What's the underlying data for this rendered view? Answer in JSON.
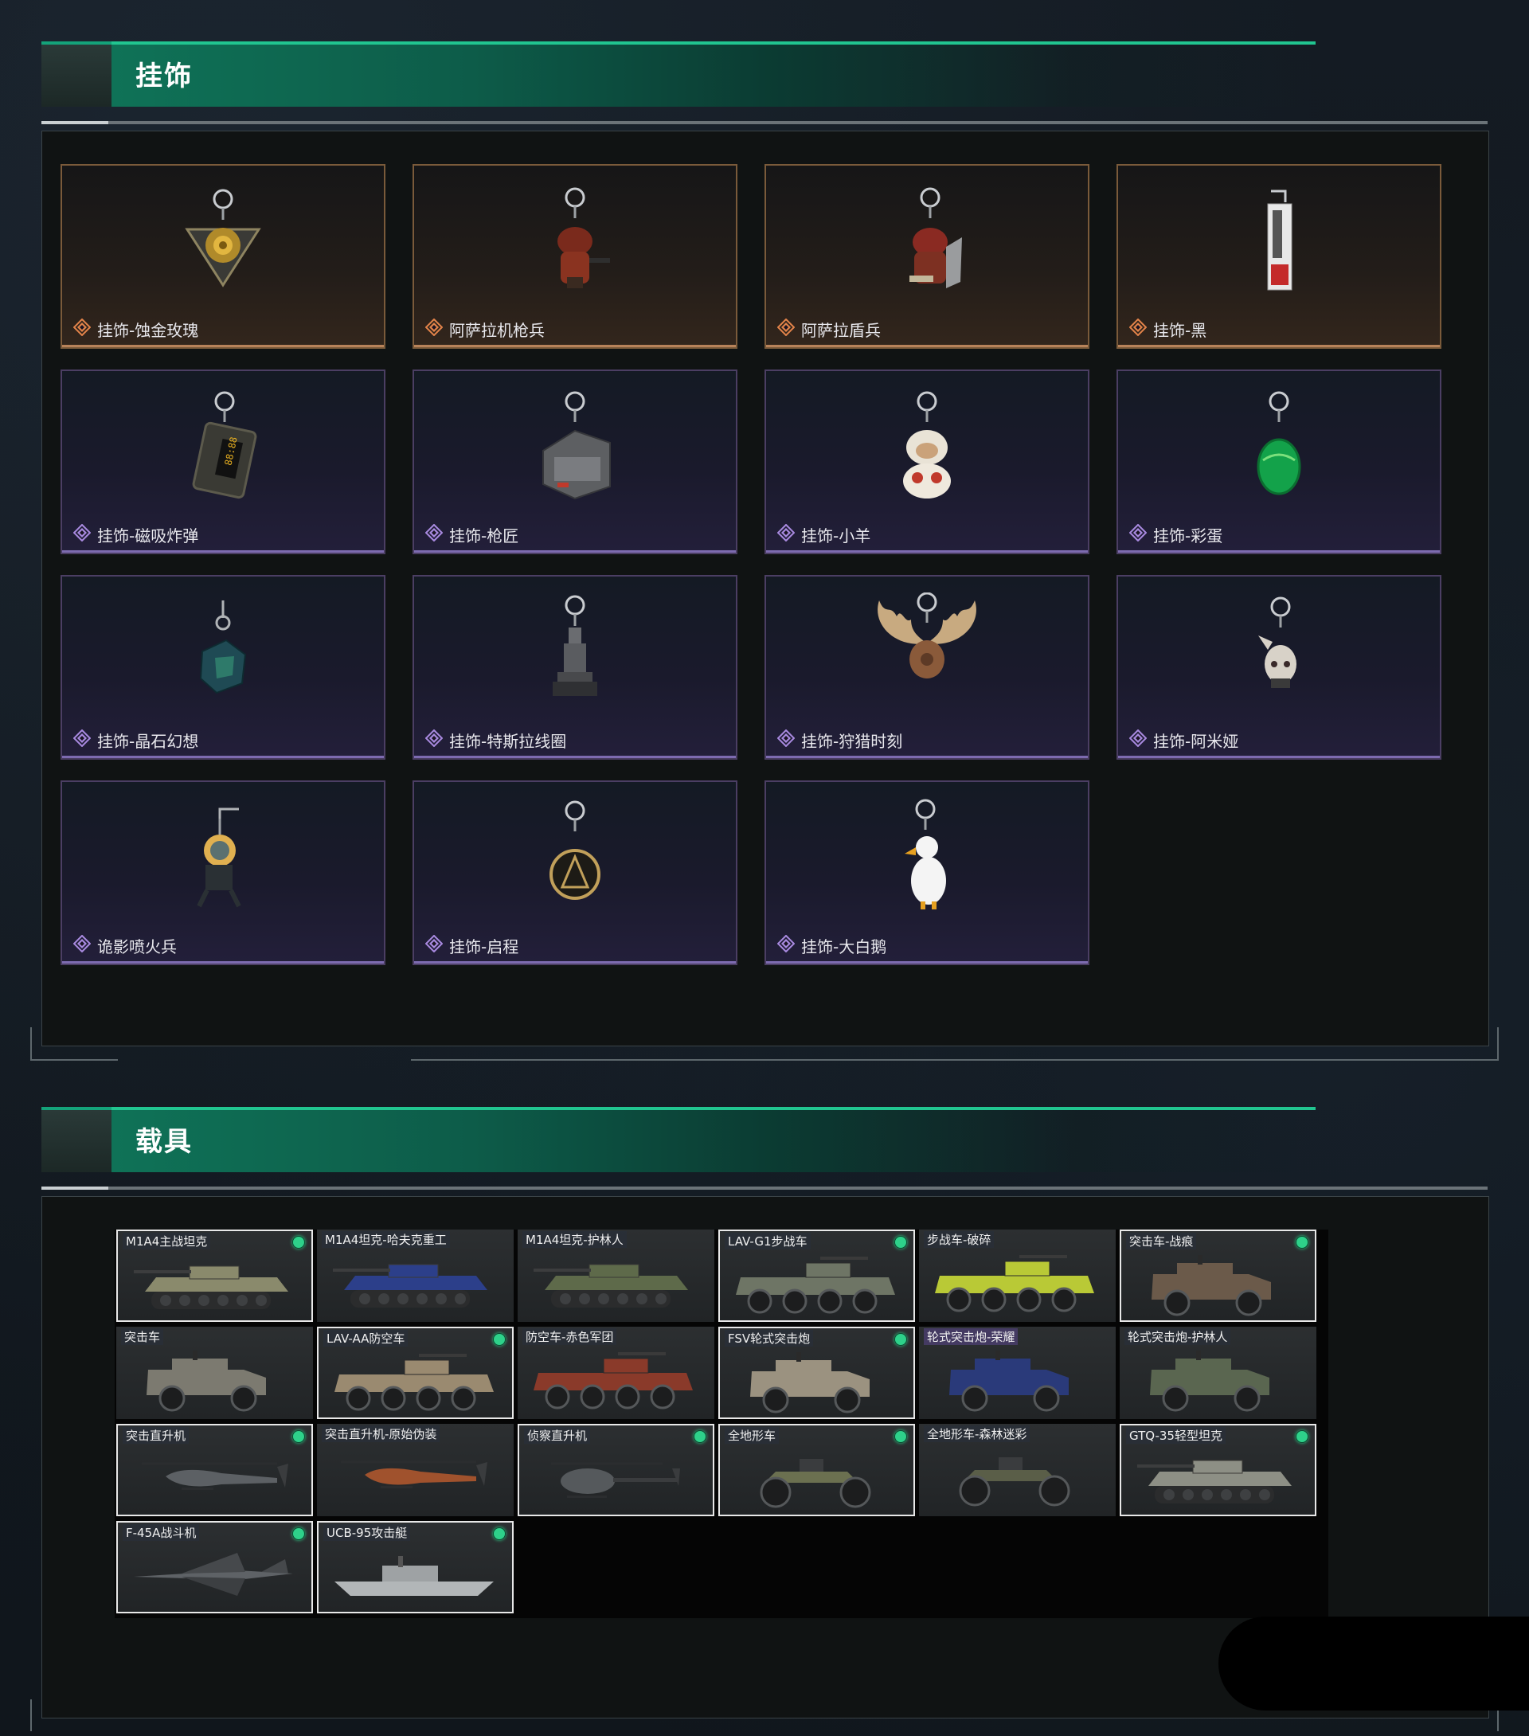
{
  "sections": {
    "charms": {
      "title": "挂饰"
    },
    "vehicles": {
      "title": "载具"
    }
  },
  "charms": [
    {
      "name": "挂饰-蚀金玫瑰",
      "rarity": "gold",
      "icon": "gilded-rose-charm"
    },
    {
      "name": "阿萨拉机枪兵",
      "rarity": "gold",
      "icon": "asara-gunner-charm"
    },
    {
      "name": "阿萨拉盾兵",
      "rarity": "gold",
      "icon": "asara-shield-charm"
    },
    {
      "name": "挂饰-黑",
      "rarity": "gold",
      "icon": "black-tag-charm"
    },
    {
      "name": "挂饰-磁吸炸弹",
      "rarity": "purple",
      "icon": "magnetic-bomb-charm"
    },
    {
      "name": "挂饰-枪匠",
      "rarity": "purple",
      "icon": "gunsmith-case-charm"
    },
    {
      "name": "挂饰-小羊",
      "rarity": "purple",
      "icon": "lamb-charm"
    },
    {
      "name": "挂饰-彩蛋",
      "rarity": "purple",
      "icon": "easter-egg-charm"
    },
    {
      "name": "挂饰-晶石幻想",
      "rarity": "purple",
      "icon": "crystal-cube-charm"
    },
    {
      "name": "挂饰-特斯拉线圈",
      "rarity": "purple",
      "icon": "tesla-coil-charm"
    },
    {
      "name": "挂饰-狩猎时刻",
      "rarity": "purple",
      "icon": "moose-antler-charm"
    },
    {
      "name": "挂饰-阿米娅",
      "rarity": "purple",
      "icon": "amiya-charm"
    },
    {
      "name": "诡影喷火兵",
      "rarity": "purple",
      "icon": "flamethrower-charm"
    },
    {
      "name": "挂饰-启程",
      "rarity": "purple",
      "icon": "departure-medal-charm"
    },
    {
      "name": "挂饰-大白鹅",
      "rarity": "purple",
      "icon": "white-goose-charm"
    }
  ],
  "vehicles": [
    {
      "name": "M1A4主战坦克",
      "owned": true,
      "kind": "tank",
      "color": "#8a8a6c"
    },
    {
      "name": "M1A4坦克-哈夫克重工",
      "owned": false,
      "kind": "tank",
      "color": "#2c3f8a"
    },
    {
      "name": "M1A4坦克-护林人",
      "owned": false,
      "kind": "tank",
      "color": "#5e6a4a"
    },
    {
      "name": "LAV-G1步战车",
      "owned": true,
      "kind": "apc",
      "color": "#6e7565"
    },
    {
      "name": "步战车-破碎",
      "owned": false,
      "kind": "apc",
      "color": "#b9c936"
    },
    {
      "name": "突击车-战痕",
      "owned": true,
      "kind": "truck",
      "color": "#6b5a4a"
    },
    {
      "name": "突击车",
      "owned": false,
      "kind": "truck",
      "color": "#7c7a70"
    },
    {
      "name": "LAV-AA防空车",
      "owned": true,
      "kind": "apc",
      "color": "#9a8a70"
    },
    {
      "name": "防空车-赤色军团",
      "owned": false,
      "kind": "apc",
      "color": "#8a3a2a"
    },
    {
      "name": "FSV轮式突击炮",
      "owned": true,
      "kind": "truck",
      "color": "#9b9280"
    },
    {
      "name": "轮式突击炮-荣耀",
      "owned": false,
      "kind": "truck",
      "color": "#2a3a7a",
      "purple": true
    },
    {
      "name": "轮式突击炮-护林人",
      "owned": false,
      "kind": "truck",
      "color": "#5a6650"
    },
    {
      "name": "突击直升机",
      "owned": true,
      "kind": "heli",
      "color": "#5c6064"
    },
    {
      "name": "突击直升机-原始伪装",
      "owned": false,
      "kind": "heli",
      "color": "#a0522d"
    },
    {
      "name": "侦察直升机",
      "owned": true,
      "kind": "scout",
      "color": "#55595c"
    },
    {
      "name": "全地形车",
      "owned": true,
      "kind": "atv",
      "color": "#6b7050"
    },
    {
      "name": "全地形车-森林迷彩",
      "owned": false,
      "kind": "atv",
      "color": "#5a5e48"
    },
    {
      "name": "GTQ-35轻型坦克",
      "owned": true,
      "kind": "tank",
      "color": "#8d8f85"
    },
    {
      "name": "F-45A战斗机",
      "owned": true,
      "kind": "jet",
      "color": "#5e6266"
    },
    {
      "name": "UCB-95攻击艇",
      "owned": true,
      "kind": "boat",
      "color": "#b2b6b8"
    }
  ],
  "colors": {
    "accent_green": "#21c590",
    "owned_dot": "#2ed18a",
    "gold_rarity": "#e2834a",
    "purple_rarity": "#a98ae0"
  }
}
